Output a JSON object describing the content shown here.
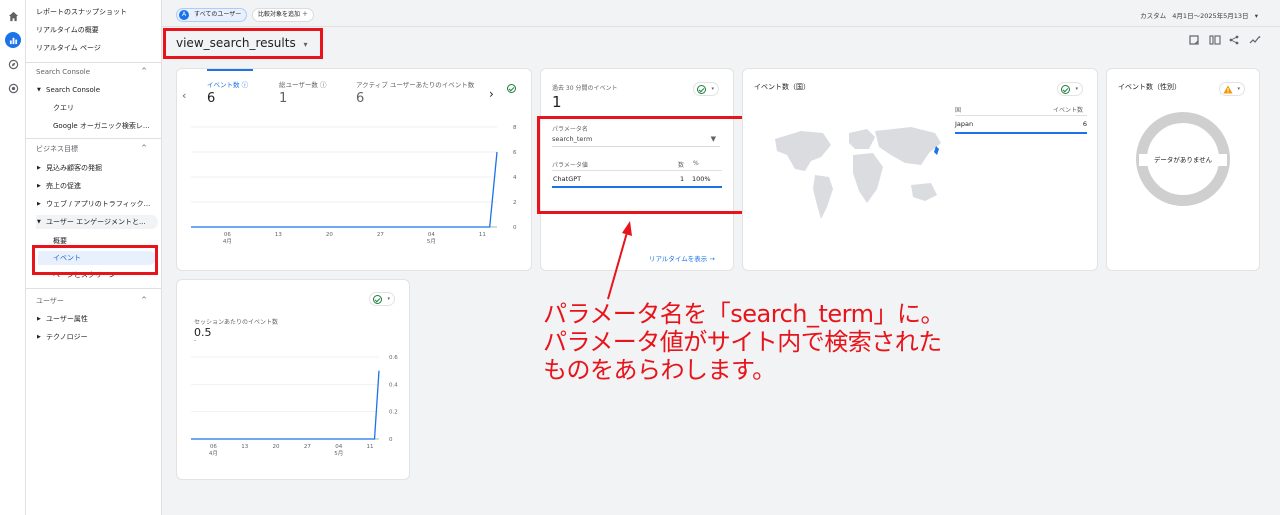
{
  "nav_rail": {
    "icons": [
      "home-icon",
      "reports-icon",
      "explore-icon",
      "advertising-icon"
    ]
  },
  "sidebar": {
    "top_items": [
      "レポートのスナップショット",
      "リアルタイムの概要",
      "リアルタイム ページ"
    ],
    "search_console": {
      "header": "Search Console",
      "parent": "Search Console",
      "children": [
        "クエリ",
        "Google オーガニック検索レ..."
      ]
    },
    "business": {
      "header": "ビジネス目標",
      "items": [
        "見込み顧客の発掘",
        "売上の促進",
        "ウェブ / アプリのトラフィック...",
        "ユーザー エンゲージメントと..."
      ],
      "children": [
        "概要",
        "イベント",
        "ページとスクリーン"
      ]
    },
    "user": {
      "header": "ユーザー",
      "items": [
        "ユーザー属性",
        "テクノロジー"
      ]
    }
  },
  "topbar": {
    "all_users_chip": "すべてのユーザー",
    "all_users_badge": "A",
    "add_comparison": "比較対象を追加",
    "date_label": "カスタム",
    "date_range": "4月1日～2025年5月13日"
  },
  "title": "view_search_results",
  "card_main": {
    "metrics": [
      {
        "label": "イベント数",
        "value": "6"
      },
      {
        "label": "総ユーザー数",
        "value": "1"
      },
      {
        "label": "アクティブ ユーザーあたりのイベント数",
        "value": "6"
      }
    ],
    "x_labels": [
      "06",
      "13",
      "20",
      "27",
      "04",
      "11"
    ],
    "x_sublabels": [
      "4月",
      "5月"
    ],
    "y_labels": [
      "8",
      "6",
      "4",
      "2",
      "0"
    ]
  },
  "card_realtime": {
    "label": "過去 30 分間のイベント",
    "value": "1",
    "param_name_label": "パラメータ名",
    "param_select": "search_term",
    "col_value": "パラメータ値",
    "col_count": "数",
    "col_pct": "%",
    "row_value": "ChatGPT",
    "row_count": "1",
    "row_pct": "100%",
    "link": "リアルタイムを表示 →"
  },
  "card_country": {
    "title": "イベント数（国）",
    "col_country": "国",
    "col_events": "イベント数",
    "row_country": "Japan",
    "row_events": "6"
  },
  "card_gender": {
    "title": "イベント数（性別）",
    "no_data": "データがありません",
    "warn": "!"
  },
  "card_session": {
    "label": "セッションあたりのイベント数",
    "value": "0.5",
    "sub": "-",
    "x_labels": [
      "06",
      "13",
      "20",
      "27",
      "04",
      "11"
    ],
    "x_sublabels": [
      "4月",
      "5月"
    ],
    "y_labels": [
      "0.6",
      "0.4",
      "0.2",
      "0"
    ]
  },
  "callout": {
    "lines": [
      "パラメータ名を「search_term」に。",
      "パラメータ値がサイト内で検索された",
      "ものをあらわします。"
    ]
  },
  "chart_data": [
    {
      "type": "line",
      "x": [
        "4/1",
        "4/6",
        "4/13",
        "4/20",
        "4/27",
        "5/4",
        "5/11",
        "5/12",
        "5/13"
      ],
      "values": [
        0,
        0,
        0,
        0,
        0,
        0,
        0,
        0,
        6
      ],
      "ylim": [
        0,
        8
      ],
      "xlabel": "",
      "ylabel": ""
    },
    {
      "type": "line",
      "x": [
        "4/1",
        "4/6",
        "4/13",
        "4/20",
        "4/27",
        "5/4",
        "5/11",
        "5/12",
        "5/13"
      ],
      "values": [
        0,
        0,
        0,
        0,
        0,
        0,
        0,
        0,
        0.5
      ],
      "ylim": [
        0,
        0.6
      ],
      "xlabel": "",
      "ylabel": ""
    }
  ],
  "colors": {
    "accent": "#1a73e8",
    "annotation_red": "#e8141b",
    "ok_green": "#188038",
    "warn_orange": "#f29900"
  }
}
